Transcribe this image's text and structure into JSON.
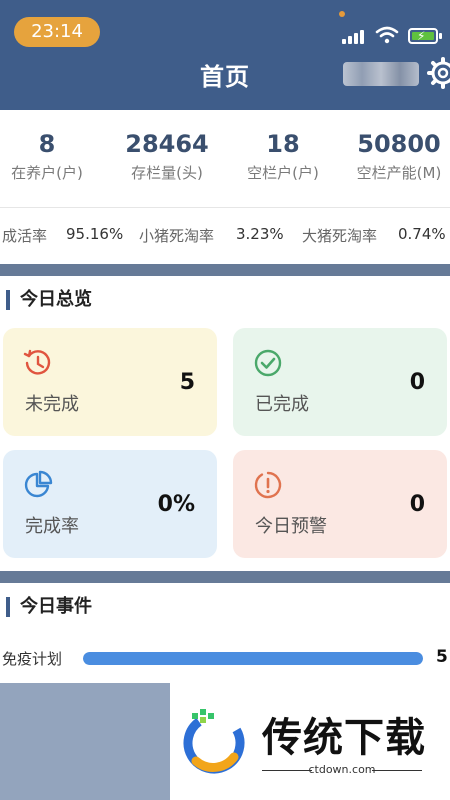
{
  "status_bar": {
    "time": "23:14"
  },
  "header": {
    "title": "首页"
  },
  "stats": [
    {
      "value": "8",
      "label": "在养户(户)"
    },
    {
      "value": "28464",
      "label": "存栏量(头)"
    },
    {
      "value": "18",
      "label": "空栏户(户)"
    },
    {
      "value": "50800",
      "label": "空栏产能(M)"
    }
  ],
  "rates": [
    {
      "label": "成活率",
      "value": "95.16%"
    },
    {
      "label": "小猪死淘率",
      "value": "3.23%"
    },
    {
      "label": "大猪死淘率",
      "value": "0.74%"
    }
  ],
  "overview": {
    "title": "今日总览",
    "cards": [
      {
        "label": "未完成",
        "value": "5",
        "icon": "clock-history-icon",
        "bg": "#fbf6dc",
        "icon_color": "#e0553f"
      },
      {
        "label": "已完成",
        "value": "0",
        "icon": "check-circle-icon",
        "bg": "#e8f5ec",
        "icon_color": "#4aa86a"
      },
      {
        "label": "完成率",
        "value": "0%",
        "icon": "pie-chart-icon",
        "bg": "#e3eff9",
        "icon_color": "#3a86d2"
      },
      {
        "label": "今日预警",
        "value": "0",
        "icon": "warning-circle-icon",
        "bg": "#fbe8e3",
        "icon_color": "#e0734f"
      }
    ]
  },
  "events": {
    "title": "今日事件",
    "items": [
      {
        "label": "免疫计划",
        "value": "5",
        "progress": 1.0
      }
    ]
  },
  "watermark": {
    "text": "传统下载",
    "url": "ctdown.com"
  },
  "colors": {
    "header_bg": "#3f5d8a",
    "accent": "#4a8de0",
    "stat_value": "#3a4f6e"
  }
}
